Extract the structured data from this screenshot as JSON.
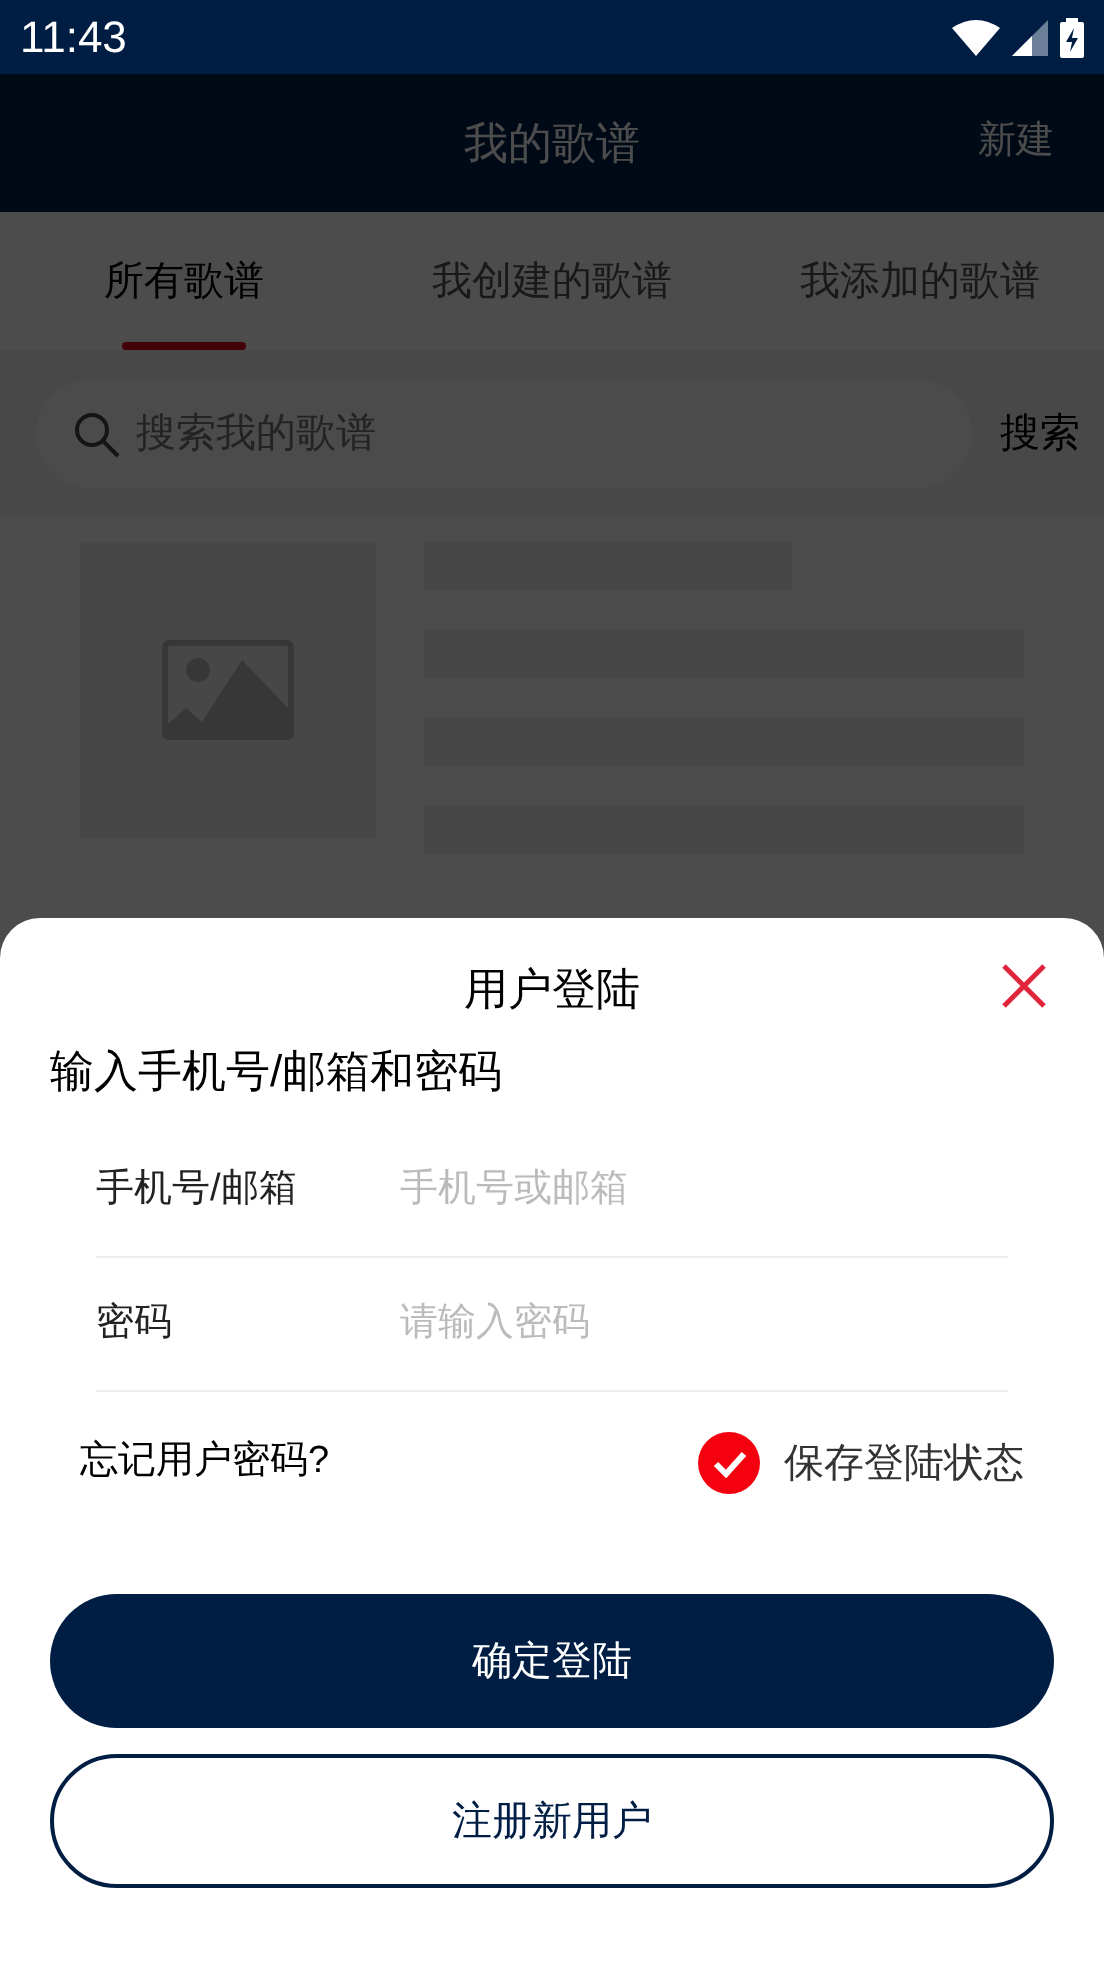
{
  "status_bar": {
    "time": "11:43"
  },
  "app_bar": {
    "title": "我的歌谱",
    "action": "新建"
  },
  "tabs": [
    {
      "label": "所有歌谱",
      "selected": true
    },
    {
      "label": "我创建的歌谱",
      "selected": false
    },
    {
      "label": "我添加的歌谱",
      "selected": false
    }
  ],
  "search": {
    "placeholder": "搜索我的歌谱",
    "button": "搜索"
  },
  "login_sheet": {
    "title": "用户登陆",
    "heading": "输入手机号/邮箱和密码",
    "fields": [
      {
        "label": "手机号/邮箱",
        "placeholder": "手机号或邮箱"
      },
      {
        "label": "密码",
        "placeholder": "请输入密码"
      }
    ],
    "forgot": "忘记用户密码?",
    "remember": {
      "label": "保存登陆状态",
      "checked": true
    },
    "login_button": "确定登陆",
    "register_button": "注册新用户"
  }
}
